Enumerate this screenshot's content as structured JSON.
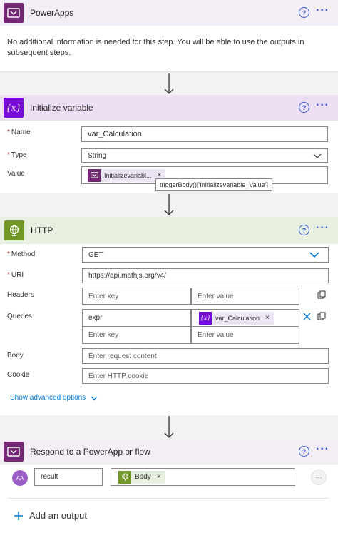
{
  "powerapps": {
    "title": "PowerApps",
    "message": "No additional information is needed for this step. You will be able to use the outputs in subsequent steps."
  },
  "init_var": {
    "title": "Initialize variable",
    "name_label": "Name",
    "name_value": "var_Calculation",
    "type_label": "Type",
    "type_value": "String",
    "value_label": "Value",
    "value_token": "Initializevariabl...",
    "tooltip": "triggerBody()['Initializevariable_Value']"
  },
  "http": {
    "title": "HTTP",
    "method_label": "Method",
    "method_value": "GET",
    "uri_label": "URI",
    "uri_value": "https://api.mathjs.org/v4/",
    "headers_label": "Headers",
    "key_placeholder": "Enter key",
    "value_placeholder": "Enter value",
    "queries_label": "Queries",
    "query_key": "expr",
    "query_token": "var_Calculation",
    "body_label": "Body",
    "body_placeholder": "Enter request content",
    "cookie_label": "Cookie",
    "cookie_placeholder": "Enter HTTP cookie",
    "advanced_label": "Show advanced options"
  },
  "respond": {
    "title": "Respond to a PowerApp or flow",
    "avatar_text": "AA",
    "output_name": "result",
    "output_token": "Body",
    "add_output_label": "Add an output"
  },
  "common": {
    "help_glyph": "?",
    "more_glyph": "···",
    "remove_glyph": "×",
    "variable_glyph": "{x}"
  },
  "colors": {
    "powerapps": "#742774",
    "variable_header": "#ecdff3",
    "variable_icon": "#770bd6",
    "http_header": "#e7efe0",
    "http_icon": "#709727",
    "accent": "#0078d4"
  }
}
